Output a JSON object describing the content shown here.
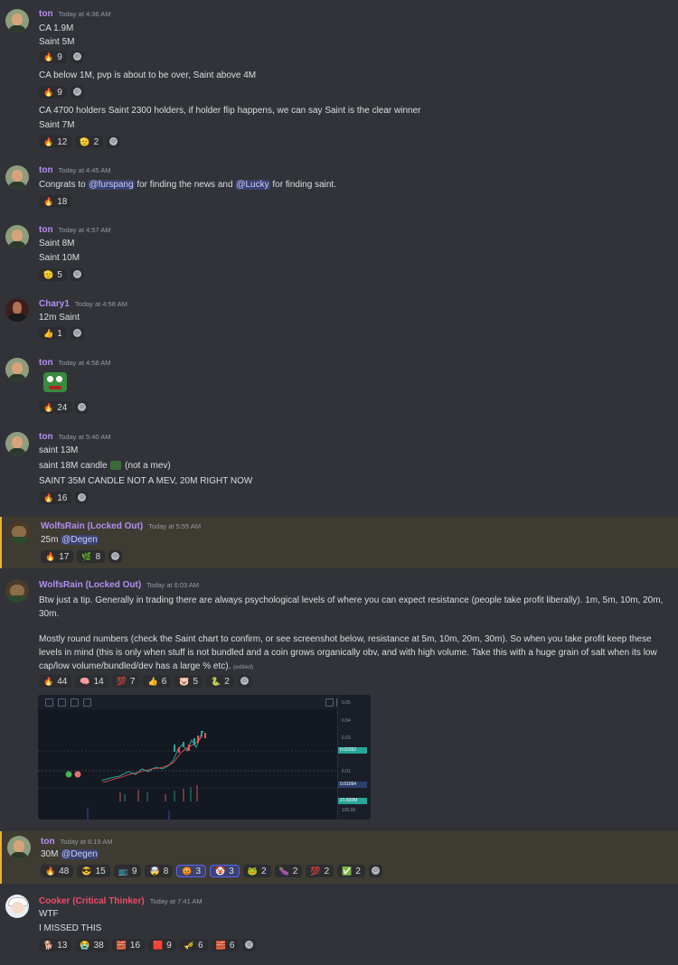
{
  "messages": [
    {
      "author": "ton",
      "timestamp": "Today at 4:36 AM",
      "lines": [
        "CA 1.9M",
        "Saint 5M"
      ],
      "reactions1": [
        {
          "emoji": "🔥",
          "count": "9"
        }
      ],
      "line3": "CA below 1M, pvp is about to be over, Saint above 4M",
      "reactions2": [
        {
          "emoji": "🔥",
          "count": "9"
        }
      ],
      "line4": "CA 4700 holders Saint 2300 holders, if holder flip happens, we can say Saint is the clear winner",
      "line5": "Saint 7M",
      "reactions3": [
        {
          "emoji": "🔥",
          "count": "12"
        },
        {
          "emoji": "🫡",
          "count": "2"
        }
      ]
    },
    {
      "author": "ton",
      "timestamp": "Today at 4:45 AM",
      "text_before": "Congrats to ",
      "mention1": "@furspang",
      "text_middle": " for finding the news and ",
      "mention2": "@Lucky",
      "text_after": " for finding saint.",
      "reactions": [
        {
          "emoji": "🔥",
          "count": "18"
        }
      ]
    },
    {
      "author": "ton",
      "timestamp": "Today at 4:57 AM",
      "lines": [
        "Saint 8M",
        "Saint 10M"
      ],
      "reactions": [
        {
          "emoji": "🫡",
          "count": "5"
        }
      ]
    },
    {
      "author": "Chary1",
      "timestamp": "Today at 4:58 AM",
      "lines": [
        "12m Saint"
      ],
      "reactions": [
        {
          "emoji": "👍",
          "count": "1"
        }
      ]
    },
    {
      "author": "ton",
      "timestamp": "Today at 4:58 AM",
      "sticker": "frog-sticker",
      "reactions": [
        {
          "emoji": "🔥",
          "count": "24"
        }
      ]
    },
    {
      "author": "ton",
      "timestamp": "Today at 5:40 AM",
      "line1": "saint 13M",
      "line2_before": "saint 18M candle",
      "line2_after": "(not a mev)",
      "line3": "SAINT 35M CANDLE NOT A MEV, 20M RIGHT NOW",
      "reactions": [
        {
          "emoji": "🔥",
          "count": "16"
        }
      ]
    },
    {
      "author": "WolfsRain (Locked Out)",
      "timestamp": "Today at 5:55 AM",
      "text": "25m ",
      "mention": "@Degen",
      "reactions": [
        {
          "emoji": "🔥",
          "count": "17"
        },
        {
          "emoji": "🌿",
          "count": "8"
        }
      ]
    },
    {
      "author": "WolfsRain (Locked Out)",
      "timestamp": "Today at 6:03 AM",
      "para1": "Btw just a tip. Generally in trading there are always psychological levels of where you can expect resistance (people take profit liberally). 1m, 5m, 10m, 20m, 30m.",
      "para2": "Mostly round numbers (check the Saint chart to confirm, or see screenshot below, resistance at 5m, 10m, 20m, 30m). So when you take profit keep these levels in mind (this is only when stuff is not bundled and a coin grows organically obv, and with high volume. Take this with a huge grain of salt when its low cap/low volume/bundled/dev has a large % etc).",
      "edited": "(edited)",
      "reactions": [
        {
          "emoji": "🔥",
          "count": "44"
        },
        {
          "emoji": "🧠",
          "count": "14"
        },
        {
          "emoji": "💯",
          "count": "7"
        },
        {
          "emoji": "👍",
          "count": "6"
        },
        {
          "emoji": "🐷",
          "count": "5"
        },
        {
          "emoji": "🐍",
          "count": "2"
        }
      ],
      "chart_axis": [
        "0.05",
        "0.04",
        "0.03",
        "0.02392",
        "0.01",
        "0.01094",
        "21.820M",
        "100.00"
      ]
    },
    {
      "author": "ton",
      "timestamp": "Today at 6:19 AM",
      "text": "30M ",
      "mention": "@Degen",
      "reactions": [
        {
          "emoji": "🔥",
          "count": "48"
        },
        {
          "emoji": "😎",
          "count": "15"
        },
        {
          "emoji": "📺",
          "count": "9"
        },
        {
          "emoji": "🤯",
          "count": "8"
        },
        {
          "emoji": "😡",
          "count": "3",
          "me": true
        },
        {
          "emoji": "🤡",
          "count": "3",
          "me": true
        },
        {
          "emoji": "🐸",
          "count": "2"
        },
        {
          "emoji": "🍆",
          "count": "2"
        },
        {
          "emoji": "💯",
          "count": "2"
        },
        {
          "emoji": "✅",
          "count": "2"
        }
      ]
    },
    {
      "author": "Cooker (Critical Thinker)",
      "timestamp": "Today at 7:41 AM",
      "lines": [
        "WTF",
        "I MISSED THIS"
      ],
      "reactions": [
        {
          "emoji": "🐕",
          "count": "13"
        },
        {
          "emoji": "😭",
          "count": "38"
        },
        {
          "emoji": "🧱",
          "count": "16"
        },
        {
          "emoji": "🟥",
          "count": "9"
        },
        {
          "emoji": "🎺",
          "count": "6"
        },
        {
          "emoji": "🧱",
          "count": "6"
        }
      ]
    }
  ]
}
